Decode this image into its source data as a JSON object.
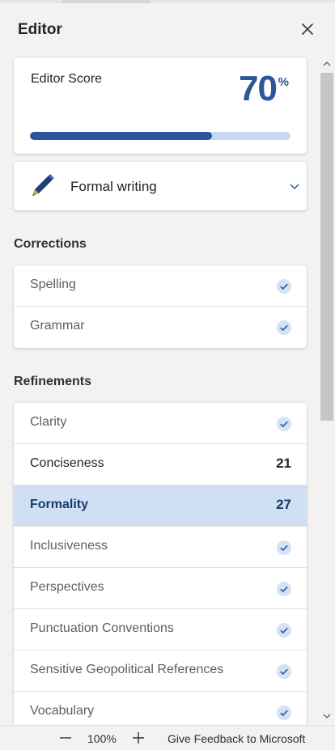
{
  "panel": {
    "title": "Editor"
  },
  "score": {
    "label": "Editor Score",
    "value": "70",
    "unit": "%",
    "progress": 0.7
  },
  "mode": {
    "label": "Formal writing"
  },
  "corrections": {
    "heading": "Corrections",
    "items": [
      {
        "label": "Spelling",
        "status": "checked"
      },
      {
        "label": "Grammar",
        "status": "checked"
      }
    ]
  },
  "refinements": {
    "heading": "Refinements",
    "items": [
      {
        "label": "Clarity",
        "status": "checked"
      },
      {
        "label": "Conciseness",
        "count": "21"
      },
      {
        "label": "Formality",
        "count": "27",
        "selected": true
      },
      {
        "label": "Inclusiveness",
        "status": "checked"
      },
      {
        "label": "Perspectives",
        "status": "checked"
      },
      {
        "label": "Punctuation Conventions",
        "status": "checked"
      },
      {
        "label": "Sensitive Geopolitical References",
        "status": "checked"
      },
      {
        "label": "Vocabulary",
        "status": "checked"
      }
    ]
  },
  "status_bar": {
    "zoom": "100%",
    "feedback": "Give Feedback to Microsoft"
  },
  "colors": {
    "accent": "#2b579a",
    "progress_track": "#c7d9f0",
    "selected_row": "#cfe0f4",
    "check_fill": "#d3e2f5"
  },
  "icons": {
    "close": "close-icon",
    "pen": "pen-icon",
    "chevron": "chevron-down-icon",
    "check": "check-circle-icon"
  }
}
